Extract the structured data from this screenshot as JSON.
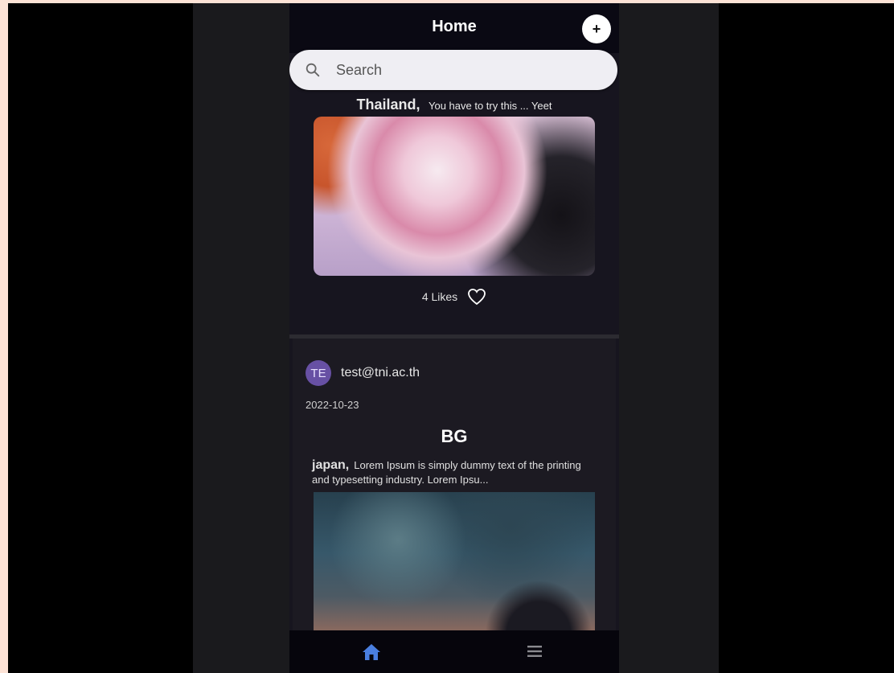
{
  "header": {
    "title": "Home",
    "add_label": "+"
  },
  "search": {
    "placeholder": "Search"
  },
  "post1": {
    "location": "Thailand,",
    "caption": "You have to try this ... Yeet",
    "likes": "4 Likes"
  },
  "post2": {
    "avatar_initials": "TE",
    "email": "test@tni.ac.th",
    "date": "2022-10-23",
    "title": "BG",
    "location": "japan,",
    "caption": "Lorem Ipsum is simply dummy text of the printing and typesetting industry. Lorem Ipsu..."
  },
  "nav": {
    "items": [
      "home-icon",
      "menu-icon"
    ],
    "active_color": "#4a7fe0"
  },
  "colors": {
    "background": "#17151f",
    "avatar": "#6750a4"
  }
}
